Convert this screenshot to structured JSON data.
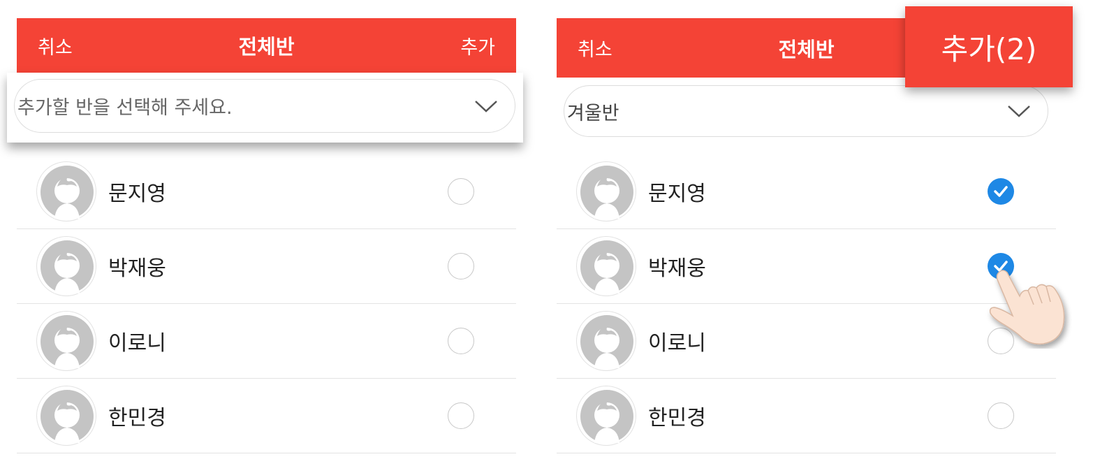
{
  "left": {
    "header": {
      "cancel": "취소",
      "title": "전체반",
      "add": "추가"
    },
    "select": {
      "placeholder": "추가할 반을 선택해 주세요."
    },
    "students": [
      {
        "name": "문지영",
        "checked": false
      },
      {
        "name": "박재웅",
        "checked": false
      },
      {
        "name": "이로니",
        "checked": false
      },
      {
        "name": "한민경",
        "checked": false
      }
    ]
  },
  "right": {
    "header": {
      "cancel": "취소",
      "title": "전체반",
      "add": "추가(2)"
    },
    "select": {
      "value": "겨울반"
    },
    "students": [
      {
        "name": "문지영",
        "checked": true
      },
      {
        "name": "박재웅",
        "checked": true
      },
      {
        "name": "이로니",
        "checked": false
      },
      {
        "name": "한민경",
        "checked": false
      }
    ]
  },
  "colors": {
    "header_bg": "#f44336",
    "check_blue": "#1e88e5",
    "avatar_gray": "#c4c4c4"
  },
  "icons": {
    "chevron": "chevron-down-icon",
    "avatar": "default-avatar-icon",
    "check": "check-icon",
    "hand": "tap-hand-pointer-icon"
  }
}
